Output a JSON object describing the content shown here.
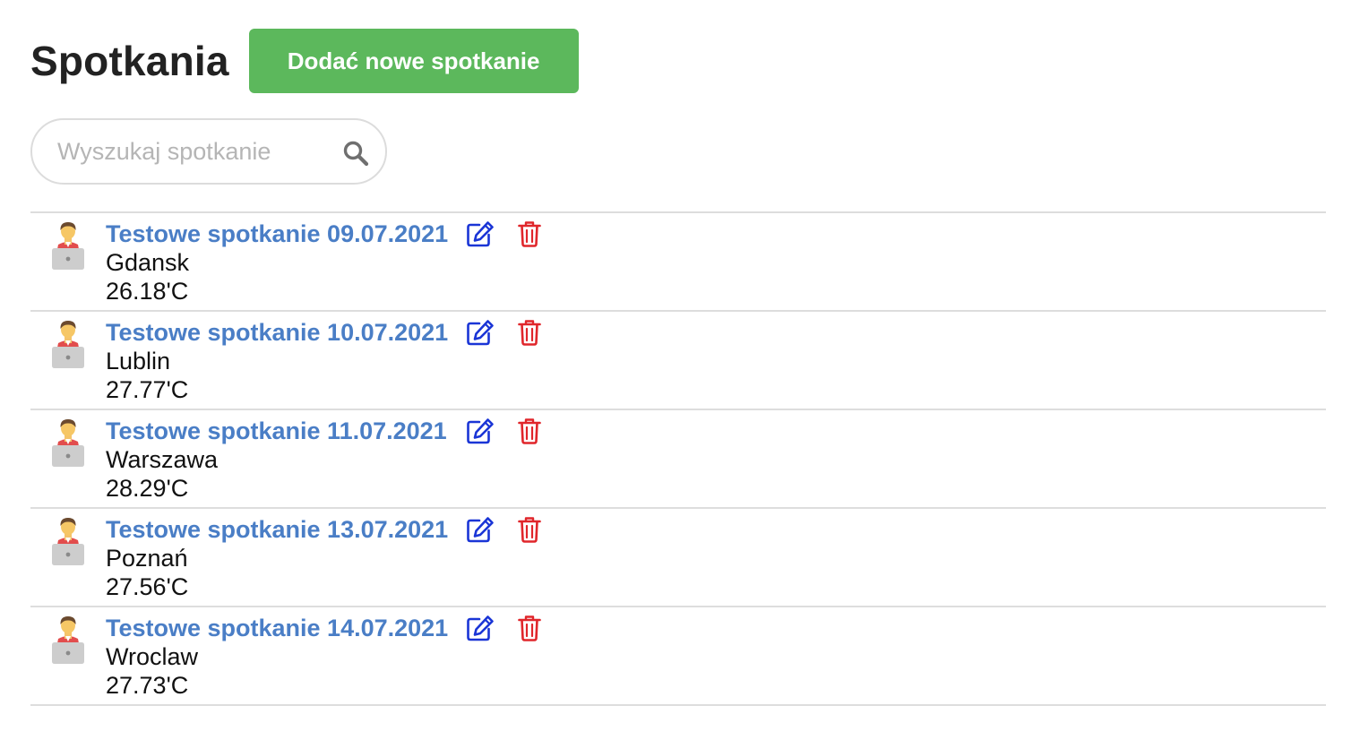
{
  "header": {
    "title": "Spotkania",
    "add_button_label": "Dodać nowe spotkanie",
    "add_button_color": "#5cb85c"
  },
  "search": {
    "placeholder": "Wyszukaj spotkanie",
    "value": "",
    "icon": "search-icon"
  },
  "colors": {
    "link": "#4a7ec6",
    "edit_icon": "#1a35d6",
    "delete_icon": "#e0262b",
    "divider": "#dddddd"
  },
  "meetings": [
    {
      "title": "Testowe spotkanie 09.07.2021",
      "city": "Gdansk",
      "temperature": "26.18'C",
      "avatar_icon": "user-laptop-icon",
      "edit_icon": "edit-icon",
      "delete_icon": "trash-icon"
    },
    {
      "title": "Testowe spotkanie 10.07.2021",
      "city": "Lublin",
      "temperature": "27.77'C",
      "avatar_icon": "user-laptop-icon",
      "edit_icon": "edit-icon",
      "delete_icon": "trash-icon"
    },
    {
      "title": "Testowe spotkanie 11.07.2021",
      "city": "Warszawa",
      "temperature": "28.29'C",
      "avatar_icon": "user-laptop-icon",
      "edit_icon": "edit-icon",
      "delete_icon": "trash-icon"
    },
    {
      "title": "Testowe spotkanie 13.07.2021",
      "city": "Poznań",
      "temperature": "27.56'C",
      "avatar_icon": "user-laptop-icon",
      "edit_icon": "edit-icon",
      "delete_icon": "trash-icon"
    },
    {
      "title": "Testowe spotkanie 14.07.2021",
      "city": "Wroclaw",
      "temperature": "27.73'C",
      "avatar_icon": "user-laptop-icon",
      "edit_icon": "edit-icon",
      "delete_icon": "trash-icon"
    }
  ]
}
